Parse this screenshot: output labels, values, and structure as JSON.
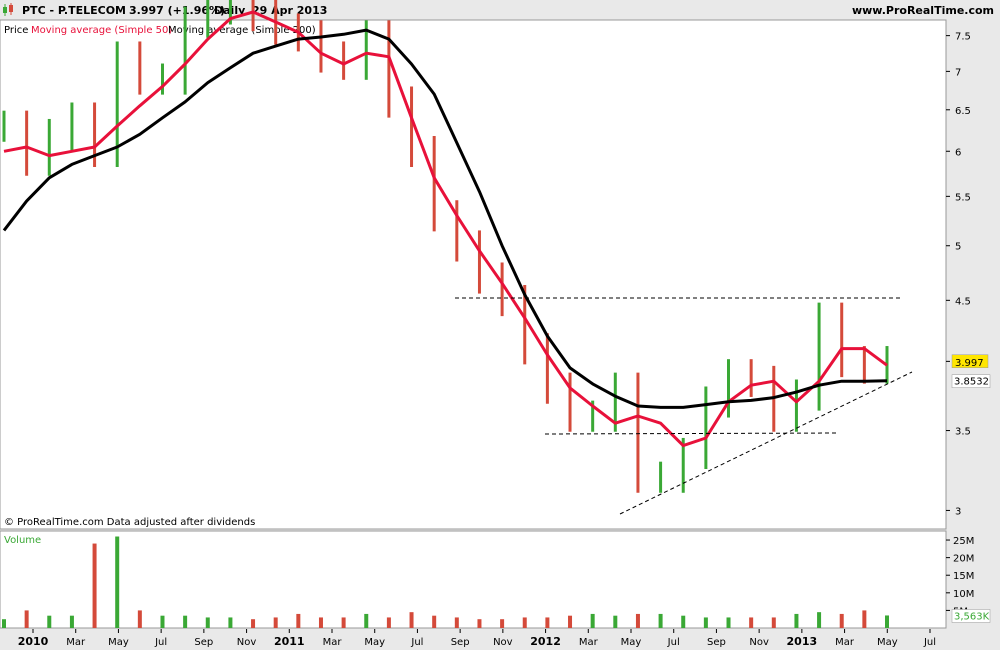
{
  "header": {
    "symbol_line": "PTC - P.TELECOM",
    "last_price": "3.997 (+1.96%)",
    "period": "Daily",
    "date": "29 Apr 2013",
    "site": "www.ProRealTime.com"
  },
  "legend": {
    "price": "Price",
    "ma50": "Moving average (Simple 50)",
    "ma200": "Moving average (Simple 200)"
  },
  "footer_note": "© ProRealTime.com  Data adjusted after dividends",
  "volume_label": "Volume",
  "colors": {
    "up": "#3aa835",
    "down": "#d44a3a",
    "ma50": "#e8113a",
    "ma200": "#000000",
    "frame_bg": "#e9e9e9",
    "volume_label": "#3aa835",
    "last_price_box": "#ffe600"
  },
  "chart_data": [
    {
      "type": "line",
      "title": "PTC - P.TELECOM",
      "ylim": [
        2.9,
        7.7
      ],
      "y_scale": "log",
      "y_ticks": [
        "7.5",
        "7",
        "6.5",
        "6",
        "5.5",
        "5",
        "4.5",
        "4",
        "3.5",
        "3"
      ],
      "x_ticks": [
        "2010",
        "Mar",
        "May",
        "Jul",
        "Sep",
        "Nov",
        "2011",
        "Mar",
        "May",
        "Jul",
        "Sep",
        "Nov",
        "2012",
        "Mar",
        "May",
        "Jul",
        "Sep",
        "Nov",
        "2013",
        "Mar",
        "May",
        "Jul"
      ],
      "last_value_label": "3.997",
      "ma200_value_label": "3.8532",
      "grid": false,
      "x": [
        "2010-01",
        "2010-02",
        "2010-03",
        "2010-04",
        "2010-05",
        "2010-06",
        "2010-07",
        "2010-08",
        "2010-09",
        "2010-10",
        "2010-11",
        "2010-12",
        "2011-01",
        "2011-02",
        "2011-03",
        "2011-04",
        "2011-05",
        "2011-06",
        "2011-07",
        "2011-08",
        "2011-09",
        "2011-10",
        "2011-11",
        "2011-12",
        "2012-01",
        "2012-02",
        "2012-03",
        "2012-04",
        "2012-05",
        "2012-06",
        "2012-07",
        "2012-08",
        "2012-09",
        "2012-10",
        "2012-11",
        "2012-12",
        "2013-01",
        "2013-02",
        "2013-03",
        "2013-04"
      ],
      "series": [
        {
          "name": "Price",
          "values": [
            6.3,
            5.9,
            6.2,
            6.4,
            6.0,
            7.2,
            6.9,
            6.9,
            7.7,
            7.9,
            8.0,
            7.8,
            7.6,
            7.5,
            7.2,
            7.1,
            7.5,
            6.6,
            6.0,
            5.3,
            5.0,
            4.7,
            4.5,
            4.1,
            3.8,
            3.6,
            3.6,
            3.8,
            3.2,
            3.2,
            3.35,
            3.7,
            3.9,
            3.85,
            3.6,
            3.75,
            4.35,
            4.0,
            3.95,
            4.0
          ]
        },
        {
          "name": "Moving average (Simple 50)",
          "values": [
            6.0,
            6.05,
            5.95,
            6.0,
            6.05,
            6.3,
            6.55,
            6.8,
            7.1,
            7.45,
            7.75,
            7.85,
            7.7,
            7.55,
            7.25,
            7.1,
            7.25,
            7.2,
            6.4,
            5.7,
            5.3,
            4.95,
            4.65,
            4.35,
            4.05,
            3.8,
            3.67,
            3.55,
            3.6,
            3.55,
            3.4,
            3.45,
            3.7,
            3.82,
            3.85,
            3.7,
            3.85,
            4.1,
            4.1,
            3.97
          ]
        },
        {
          "name": "Moving average (Simple 200)",
          "values": [
            5.15,
            5.45,
            5.7,
            5.85,
            5.95,
            6.05,
            6.2,
            6.4,
            6.6,
            6.85,
            7.05,
            7.25,
            7.35,
            7.45,
            7.48,
            7.52,
            7.58,
            7.45,
            7.1,
            6.7,
            6.1,
            5.55,
            5.0,
            4.55,
            4.2,
            3.95,
            3.83,
            3.74,
            3.67,
            3.66,
            3.66,
            3.68,
            3.7,
            3.71,
            3.73,
            3.77,
            3.82,
            3.85,
            3.85,
            3.8532
          ]
        }
      ]
    },
    {
      "type": "bar",
      "title": "Volume",
      "ylim": [
        0,
        27
      ],
      "y_ticks": [
        "25M",
        "20M",
        "15M",
        "10M",
        "5M"
      ],
      "last_value_label": "3,563K",
      "values": [
        2.5,
        5,
        3.5,
        3.5,
        24,
        26,
        5,
        3.5,
        3.5,
        3,
        3,
        2.5,
        3,
        4,
        3,
        3,
        4,
        3,
        4.5,
        3.5,
        3,
        2.5,
        2.5,
        3,
        3,
        3.5,
        4,
        3.5,
        4,
        4,
        3.5,
        3,
        3,
        3,
        3,
        4,
        4.5,
        4,
        5,
        3.563
      ]
    }
  ]
}
